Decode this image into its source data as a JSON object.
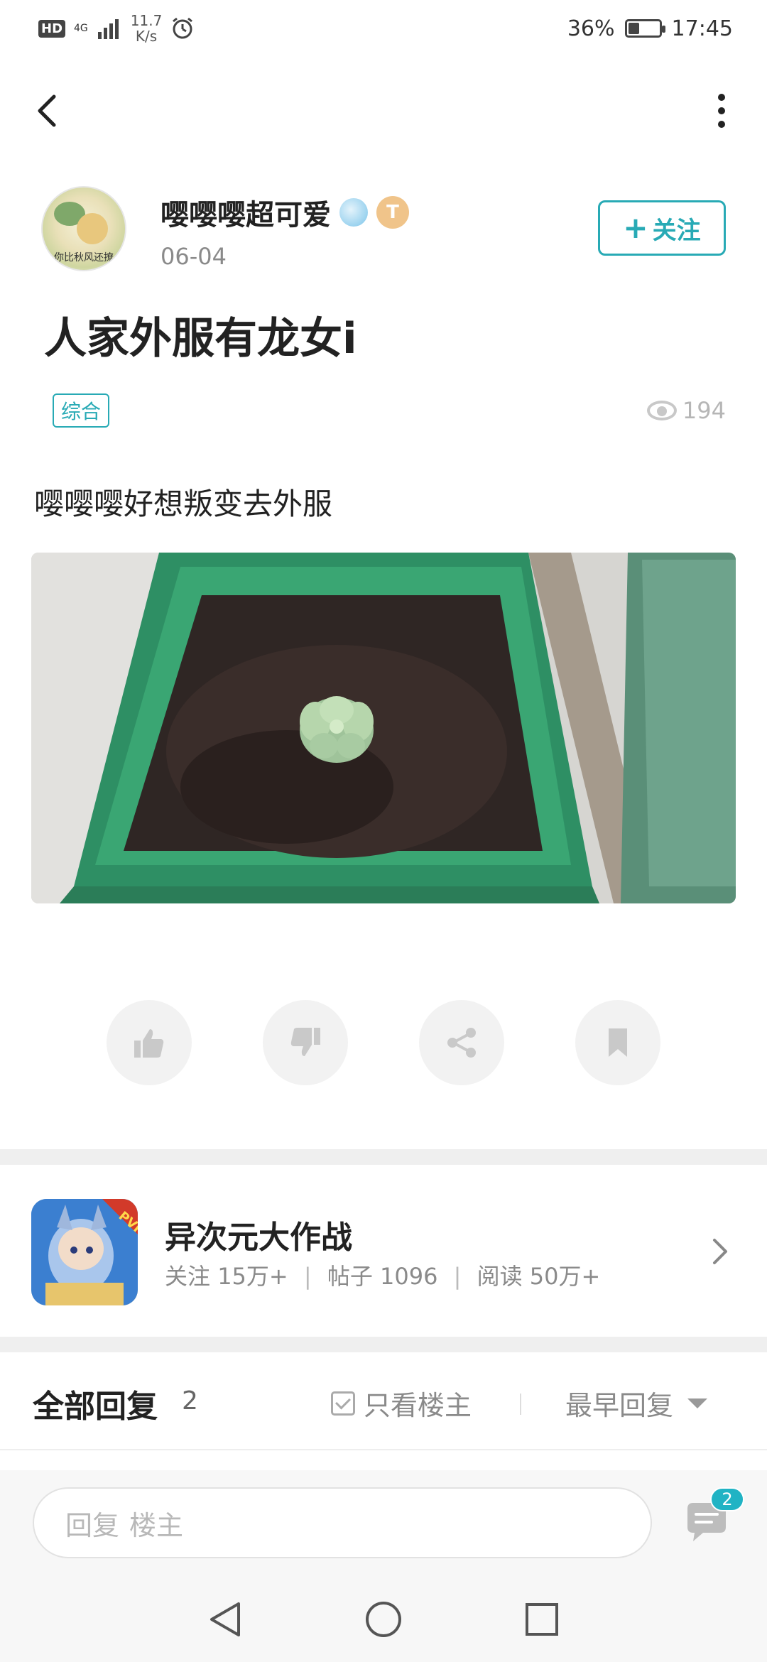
{
  "status_bar": {
    "hd": "HD",
    "network": "4G",
    "speed_value": "11.7",
    "speed_unit": "K/s",
    "battery_percent": "36%",
    "battery_level": 0.36,
    "time": "17:45"
  },
  "nav": {
    "back_icon": "chevron-left-icon",
    "more_icon": "more-vertical-icon"
  },
  "author": {
    "name": "嘤嘤嘤超可爱",
    "date": "06-04",
    "avatar_caption": "你比秋风还撩",
    "level_badge": "T",
    "follow_label": "关注",
    "follow_plus": "+"
  },
  "post": {
    "title": "人家外服有龙女i",
    "tag": "综合",
    "views": "194",
    "text": "嘤嘤嘤好想叛变去外服",
    "image_icon": "succulent-plant-photo"
  },
  "actions": [
    {
      "name": "like-button",
      "icon": "thumbs-up-icon"
    },
    {
      "name": "dislike-button",
      "icon": "thumbs-down-icon"
    },
    {
      "name": "share-button",
      "icon": "share-icon"
    },
    {
      "name": "bookmark-button",
      "icon": "bookmark-icon"
    }
  ],
  "game": {
    "name": "异次元大作战",
    "follow_label": "关注",
    "follow_count": "15万+",
    "posts_label": "帖子",
    "posts_count": "1096",
    "reads_label": "阅读",
    "reads_count": "50万+",
    "sep": "|",
    "icon_badge": "PVP"
  },
  "replies": {
    "title": "全部回复",
    "count": "2",
    "only_owner": "只看楼主",
    "sort": "最早回复"
  },
  "reply_bar": {
    "placeholder_prefix": "回复",
    "placeholder_target": "楼主",
    "comment_badge": "2"
  },
  "colors": {
    "accent": "#28aab5",
    "badge": "#20b3c4"
  }
}
